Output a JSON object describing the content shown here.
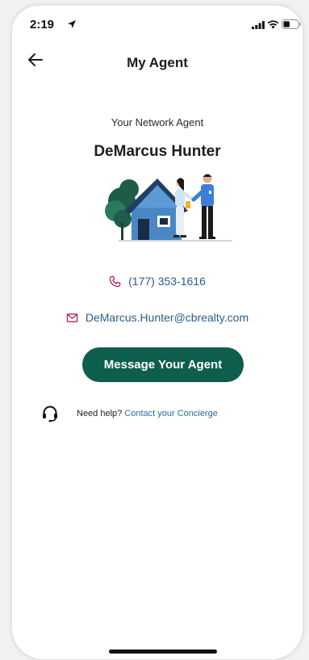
{
  "status_bar": {
    "time": "2:19"
  },
  "header": {
    "title": "My Agent",
    "back_icon": "arrow-left-icon"
  },
  "agent": {
    "subtitle": "Your Network Agent",
    "name": "DeMarcus Hunter",
    "phone": "(177) 353-1616",
    "email": "DeMarcus.Hunter@cbrealty.com"
  },
  "actions": {
    "message_label": "Message Your Agent"
  },
  "help": {
    "text": "Need help?",
    "link_label": "Contact your Concierge"
  },
  "colors": {
    "brand_green": "#0e5e4d",
    "link_blue": "#2c5d86",
    "icon_magenta": "#b0245e"
  }
}
